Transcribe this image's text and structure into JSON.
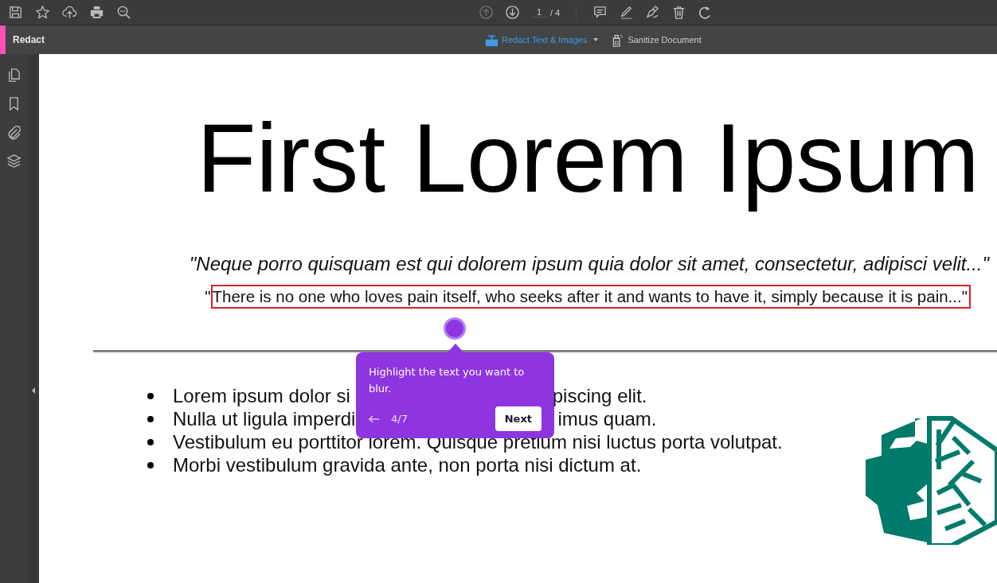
{
  "toolbar": {
    "prev_page_disabled": true,
    "page_field": {
      "value": "1"
    },
    "page_count": "/ 4"
  },
  "mode_bar": {
    "title": "Redact",
    "tools": [
      {
        "label": "Redact Text & Images",
        "selected": true
      },
      {
        "label": "Sanitize Document",
        "selected": false
      }
    ]
  },
  "document": {
    "title": "First Lorem Ipsum",
    "quote": "\"Neque porro quisquam est qui dolorem ipsum quia dolor sit amet, consectetur, adipisci velit...\"",
    "highlighted_quote": {
      "open_mark": "\"",
      "text": "There is no one who loves pain itself, who seeks after it and wants to have it, simply because it is pain...\""
    },
    "bullets": [
      {
        "before": "Lorem ipsum dolor si",
        "after": "piscing elit."
      },
      {
        "before": "Nulla ut ligula imperdi",
        "after": "imus quam."
      },
      {
        "before": "Vestibulum eu porttitor lorem. Quisque pretium nisi luctus porta volutpat."
      },
      {
        "before": "Morbi vestibulum gravida ante, non porta nisi dictum at."
      }
    ]
  },
  "tour_popup": {
    "message": "Highlight the text you want to blur.",
    "progress": "4/7",
    "button": "Next"
  }
}
